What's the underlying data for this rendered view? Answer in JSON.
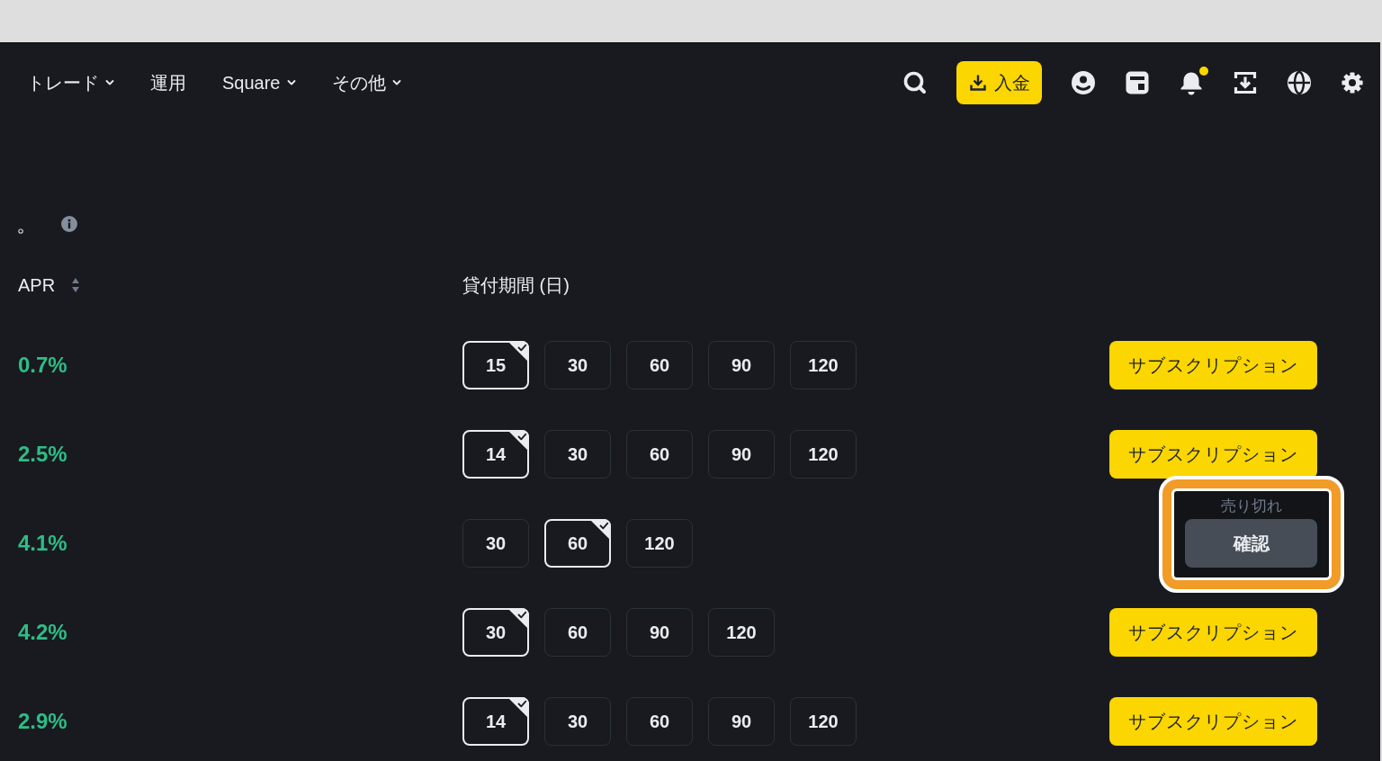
{
  "nav": {
    "menu": [
      {
        "label": "トレード",
        "dropdown": true
      },
      {
        "label": "運用",
        "dropdown": false
      },
      {
        "label": "Square",
        "dropdown": true
      },
      {
        "label": "その他",
        "dropdown": true
      }
    ],
    "deposit_button": "入金",
    "notifications_unread": true
  },
  "description": {
    "text": "。"
  },
  "table": {
    "columns": [
      {
        "label": "APR",
        "sortable": true
      },
      {
        "label": "貸付期間 (日)",
        "sortable": false
      }
    ],
    "rows": [
      {
        "apr": "0.7%",
        "terms": [
          {
            "label": "15",
            "selected": true
          },
          {
            "label": "30",
            "selected": false
          },
          {
            "label": "60",
            "selected": false
          },
          {
            "label": "90",
            "selected": false
          },
          {
            "label": "120",
            "selected": false
          }
        ],
        "kind": "subscribe",
        "action": "サブスクリプション",
        "highlighted": false
      },
      {
        "apr": "2.5%",
        "terms": [
          {
            "label": "14",
            "selected": true
          },
          {
            "label": "30",
            "selected": false
          },
          {
            "label": "60",
            "selected": false
          },
          {
            "label": "90",
            "selected": false
          },
          {
            "label": "120",
            "selected": false
          }
        ],
        "kind": "subscribe",
        "action": "サブスクリプション",
        "highlighted": false
      },
      {
        "apr": "4.1%",
        "terms": [
          {
            "label": "30",
            "selected": false
          },
          {
            "label": "60",
            "selected": true
          },
          {
            "label": "120",
            "selected": false
          }
        ],
        "kind": "sold_out",
        "status": "売り切れ",
        "action": "確認",
        "highlighted": true
      },
      {
        "apr": "4.2%",
        "terms": [
          {
            "label": "30",
            "selected": true
          },
          {
            "label": "60",
            "selected": false
          },
          {
            "label": "90",
            "selected": false
          },
          {
            "label": "120",
            "selected": false
          }
        ],
        "kind": "subscribe",
        "action": "サブスクリプション",
        "highlighted": false
      },
      {
        "apr": "2.9%",
        "terms": [
          {
            "label": "14",
            "selected": true
          },
          {
            "label": "30",
            "selected": false
          },
          {
            "label": "60",
            "selected": false
          },
          {
            "label": "90",
            "selected": false
          },
          {
            "label": "120",
            "selected": false
          }
        ],
        "kind": "subscribe",
        "action": "サブスクリプション",
        "highlighted": false
      }
    ]
  }
}
